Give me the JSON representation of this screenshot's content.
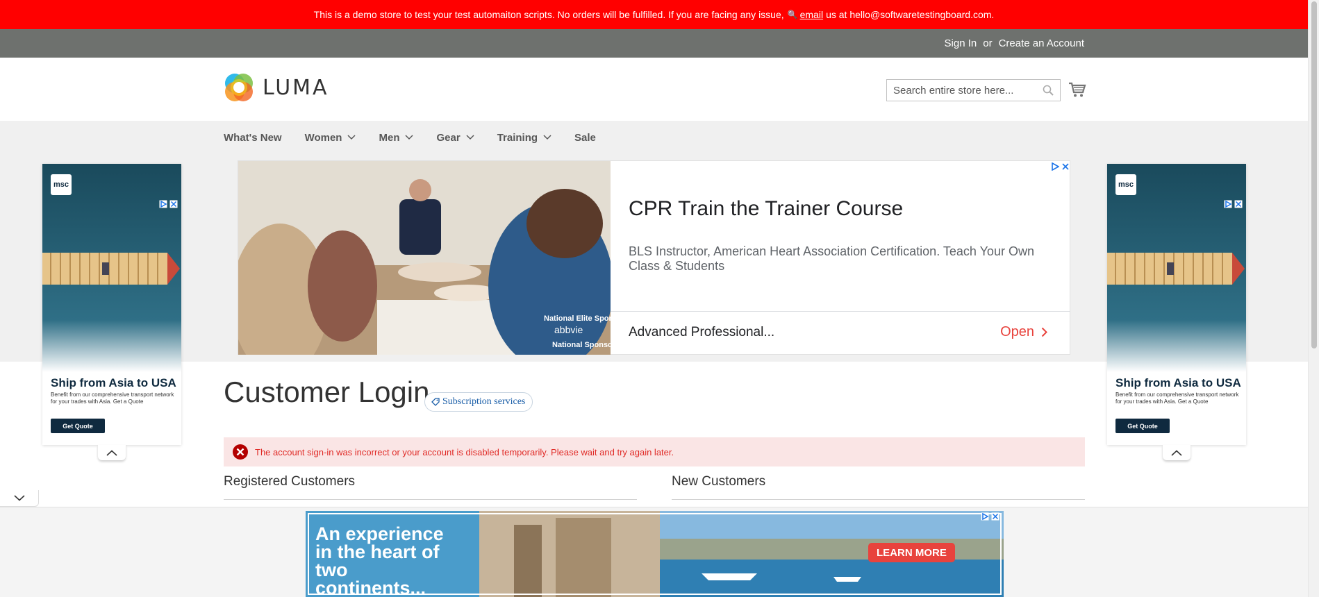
{
  "demo_notice": {
    "text_before": "This is a demo store to test your test automaiton scripts. No orders will be fulfilled. If you are facing any issue,",
    "email_link": "email",
    "text_after": "us at hello@softwaretestingboard.com."
  },
  "header_links": {
    "sign_in": "Sign In",
    "or": "or",
    "create_account": "Create an Account"
  },
  "logo": {
    "text": "LUMA"
  },
  "search": {
    "placeholder": "Search entire store here..."
  },
  "nav": {
    "items": [
      {
        "label": "What's New",
        "has_submenu": false
      },
      {
        "label": "Women",
        "has_submenu": true
      },
      {
        "label": "Men",
        "has_submenu": true
      },
      {
        "label": "Gear",
        "has_submenu": true
      },
      {
        "label": "Training",
        "has_submenu": true
      },
      {
        "label": "Sale",
        "has_submenu": false
      }
    ]
  },
  "top_ad": {
    "title": "CPR Train the Trainer Course",
    "description": "BLS Instructor, American Heart Association Certification. Teach Your Own Class & Students",
    "advertiser": "Advanced Professional...",
    "cta": "Open",
    "photo_text_1": "National Elite Sponsor",
    "photo_text_2": "abbvie",
    "photo_text_3": "National Sponsor"
  },
  "side_ad": {
    "badge": "msc",
    "title": "Ship from Asia to USA",
    "description": "Benefit from our comprehensive transport network for your trades with Asia. Get a Quote",
    "button": "Get Quote"
  },
  "page": {
    "title": "Customer Login",
    "subscription_pill": "Subscription services",
    "error_message": "The account sign-in was incorrect or your account is disabled temporarily. Please wait and try again later.",
    "registered_title": "Registered Customers",
    "new_title": "New Customers"
  },
  "bottom_ad": {
    "headline": "An experience in the heart of two continents...",
    "cta": "LEARN MORE"
  },
  "colors": {
    "demo_bar": "#ff0000",
    "header_panel": "#6e716e",
    "nav_bg": "#f0f0f0",
    "error_bg": "#fae5e5",
    "error_text": "#e02b27",
    "ad_cta": "#e8433d",
    "side_ad_navy": "#0f2a3f"
  }
}
